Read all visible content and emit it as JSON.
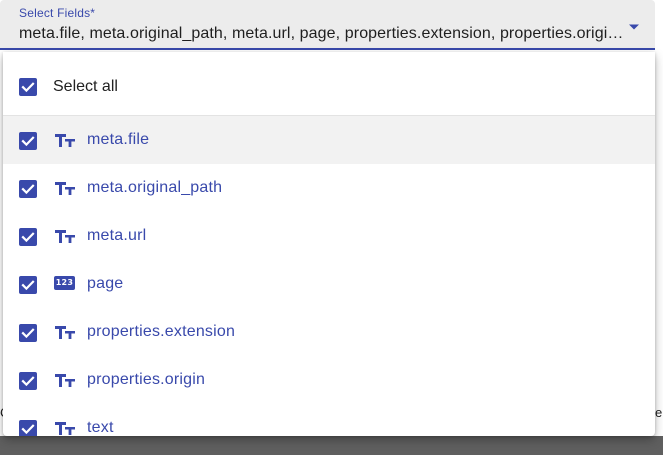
{
  "select": {
    "label": "Select Fields*",
    "value": "meta.file, meta.original_path, meta.url, page, properties.extension, properties.origin, text"
  },
  "menu": {
    "select_all_label": "Select all",
    "options": [
      {
        "label": "meta.file",
        "type_icon": "text-type-icon",
        "checked": true
      },
      {
        "label": "meta.original_path",
        "type_icon": "text-type-icon",
        "checked": true
      },
      {
        "label": "meta.url",
        "type_icon": "text-type-icon",
        "checked": true
      },
      {
        "label": "page",
        "type_icon": "number-type-icon",
        "badge": "123",
        "checked": true
      },
      {
        "label": "properties.extension",
        "type_icon": "text-type-icon",
        "checked": true
      },
      {
        "label": "properties.origin",
        "type_icon": "text-type-icon",
        "checked": true
      },
      {
        "label": "text",
        "type_icon": "text-type-icon",
        "checked": true
      }
    ]
  },
  "colors": {
    "accent": "#3949ab",
    "field_background": "#ececec",
    "highlight_row": "#f2f2f2"
  }
}
